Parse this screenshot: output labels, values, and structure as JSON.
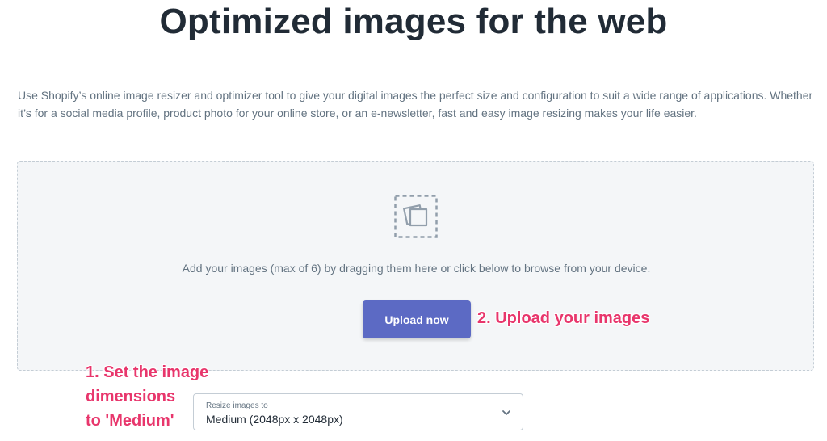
{
  "page": {
    "title": "Optimized images for the web",
    "intro": "Use Shopify’s online image resizer and optimizer tool to give your digital images the perfect size and configuration to suit a wide range of applications. Whether it’s for a social media profile, product photo for your online store, or an e-newsletter, fast and easy image resizing makes your life easier."
  },
  "dropzone": {
    "icon": "images-icon",
    "hint": "Add your images (max of 6) by dragging them here or click below to browse from your device.",
    "upload_label": "Upload now"
  },
  "resize": {
    "caption": "Resize images to",
    "selected": "Medium (2048px x 2048px)",
    "chevron_icon": "chevron-down-icon"
  },
  "annotations": {
    "upload": "2. Upload your images",
    "set_line1": "1. Set the image",
    "set_line2": "dimensions",
    "set_line3": "to 'Medium'"
  },
  "colors": {
    "accent": "#5c6ac4",
    "annotation": "#e8366c",
    "title_text": "#212b36",
    "body_text": "#637381",
    "dropzone_bg": "#f4f6f8"
  }
}
